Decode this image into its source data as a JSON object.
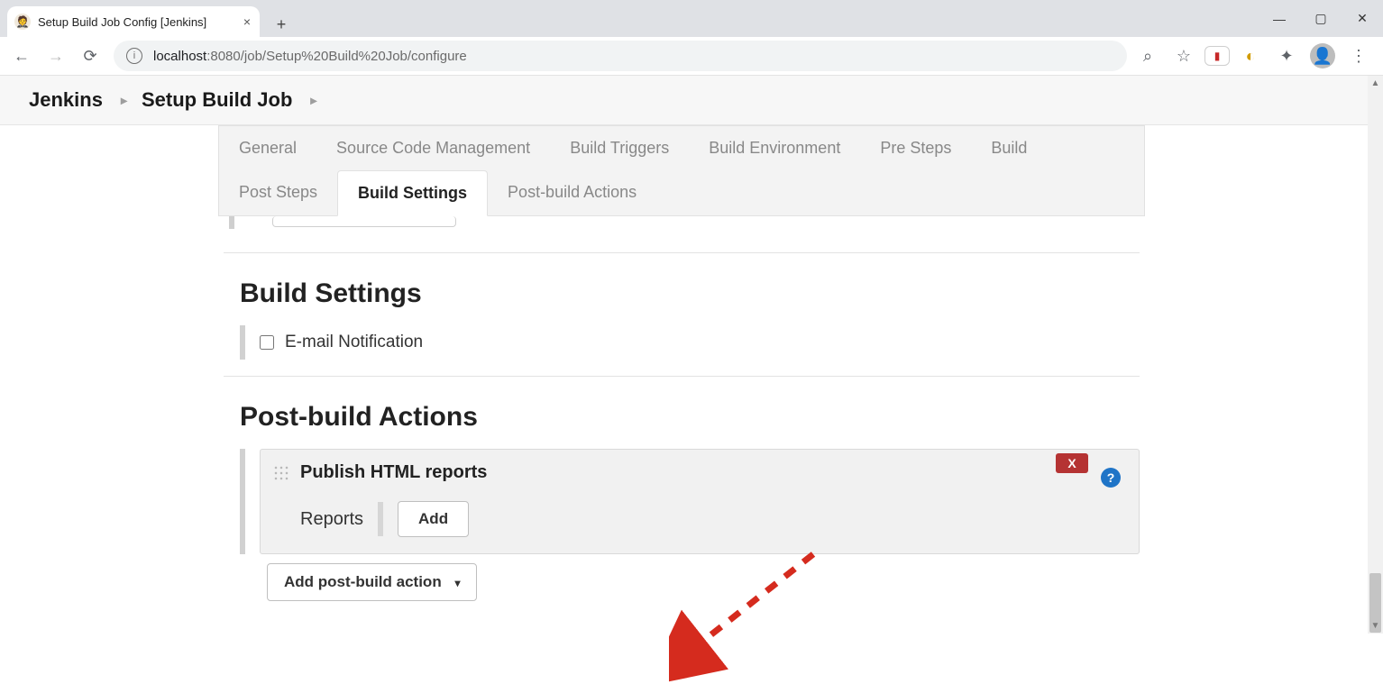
{
  "browser": {
    "tab_title": "Setup Build Job Config [Jenkins]",
    "url_host": "localhost",
    "url_port_path": ":8080/job/Setup%20Build%20Job/configure"
  },
  "breadcrumbs": {
    "root": "Jenkins",
    "item": "Setup Build Job"
  },
  "tabs": {
    "general": "General",
    "scm": "Source Code Management",
    "triggers": "Build Triggers",
    "env": "Build Environment",
    "presteps": "Pre Steps",
    "build": "Build",
    "poststeps": "Post Steps",
    "buildsettings": "Build Settings",
    "postbuild": "Post-build Actions"
  },
  "sections": {
    "build_settings_title": "Build Settings",
    "email_label": "E-mail Notification",
    "pba_title": "Post-build Actions"
  },
  "publish_block": {
    "title": "Publish HTML reports",
    "delete_label": "X",
    "help_label": "?",
    "reports_label": "Reports",
    "add_label": "Add"
  },
  "add_post_build_action": "Add post-build action",
  "caret": "▾"
}
